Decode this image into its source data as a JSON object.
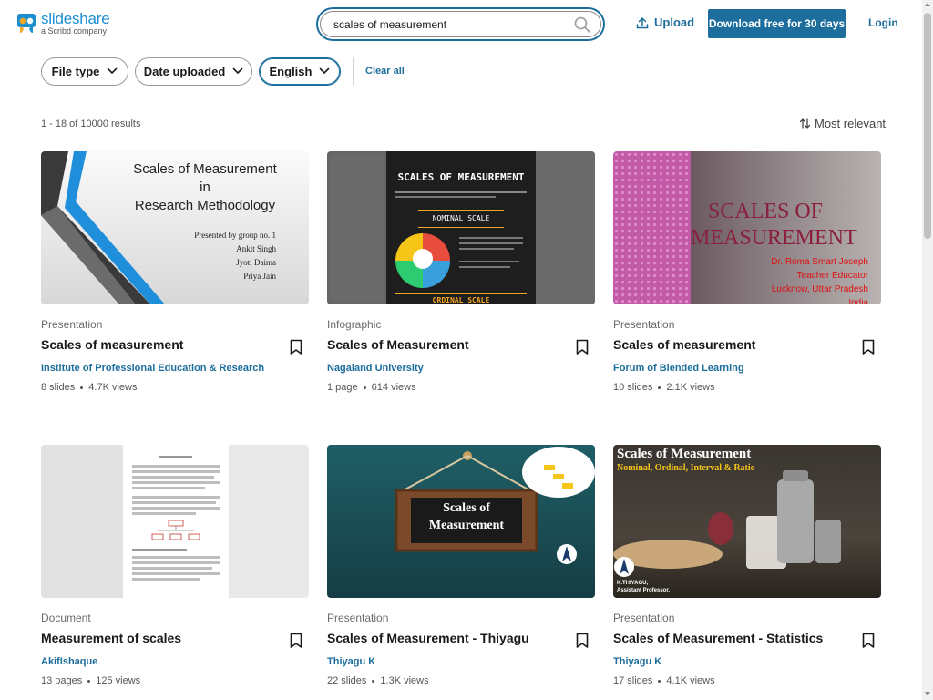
{
  "header": {
    "logo_main": "slideshare",
    "logo_sub": "a Scribd company",
    "search_value": "scales of measurement",
    "upload_label": "Upload",
    "download_label": "Download free for 30 days",
    "login_label": "Login"
  },
  "filters": {
    "file_type": "File type",
    "date_uploaded": "Date uploaded",
    "language": "English",
    "clear_all": "Clear all"
  },
  "results": {
    "count": "1 - 18 of 10000 results",
    "sort": "Most relevant"
  },
  "cards": [
    {
      "type": "Presentation",
      "title": "Scales of measurement",
      "author": "Institute of Professional Education & Research",
      "size": "8 slides",
      "views": "4.7K views"
    },
    {
      "type": "Infographic",
      "title": "Scales of Measurement",
      "author": "Nagaland University",
      "size": "1 page",
      "views": "614 views"
    },
    {
      "type": "Presentation",
      "title": "Scales of measurement",
      "author": "Forum of Blended Learning",
      "size": "10 slides",
      "views": "2.1K views"
    },
    {
      "type": "Document",
      "title": "Measurement of scales",
      "author": "AkifIshaque",
      "size": "13 pages",
      "views": "125 views"
    },
    {
      "type": "Presentation",
      "title": "Scales of Measurement - Thiyagu",
      "author": "Thiyagu K",
      "size": "22 slides",
      "views": "1.3K views"
    },
    {
      "type": "Presentation",
      "title": "Scales of Measurement - Statistics",
      "author": "Thiyagu K",
      "size": "17 slides",
      "views": "4.1K views"
    }
  ],
  "thumbs": {
    "t1": {
      "l1": "Scales of Measurement",
      "l2": "in",
      "l3": "Research Methodology",
      "l4": "Presented by group no. 1",
      "l5": "Ankit Singh",
      "l6": "Jyoti Daima",
      "l7": "Priya Jain"
    },
    "t2": {
      "title": "SCALES OF MEASUREMENT",
      "sub": "NOMINAL SCALE",
      "bottom": "ORDINAL SCALE"
    },
    "t3": {
      "l1": "SCALES OF",
      "l2": "MEASUREMENT",
      "a1": "Dr. Roma Smart Joseph",
      "a2": "Teacher Educator",
      "a3": "Lucknow, Uttar Pradesh",
      "a4": "India"
    },
    "t5": {
      "sign1": "Scales of",
      "sign2": "Measurement"
    },
    "t6": {
      "l1": "Scales of Measurement",
      "l2": "Nominal, Ordinal, Interval & Ratio",
      "a1": "K.THIYAGU,",
      "a2": "Assistant Professor,"
    }
  },
  "colors": {
    "accent": "#1d6e9c",
    "brand": "#1d8fd0"
  }
}
